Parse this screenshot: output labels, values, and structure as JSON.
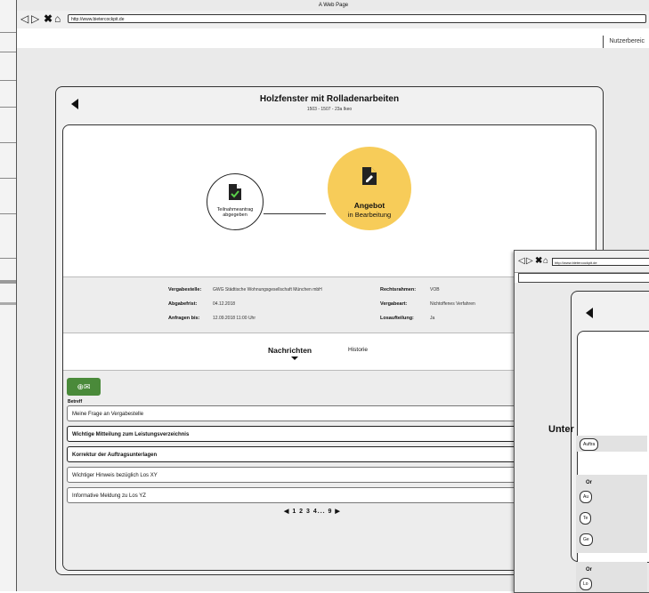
{
  "browser": {
    "window_title": "A Web Page",
    "url": "http://www.bietercockpit.de",
    "user_area": "Nutzerbereic"
  },
  "project": {
    "title": "Holzfenster mit Rolladenarbeiten",
    "subtitle": "1503 - 1507 - 23a Ikeo"
  },
  "status": {
    "step1_label": "Teilnahmeantrag abgegeben",
    "step2_title": "Angebot",
    "step2_sub": "in Bearbeitung",
    "accent_color": "#f7cc59"
  },
  "meta": {
    "vergabestelle_label": "Vergabestelle:",
    "vergabestelle_value": "GWG Städtische Wohnungsgesellschaft München mbH",
    "abgabefrist_label": "Abgabefrist:",
    "abgabefrist_value": "04.12.2018",
    "anfragen_label": "Anfragen bis:",
    "anfragen_value": "12.09.2018 11:00 Uhr",
    "rechtsrahmen_label": "Rechtsrahmen:",
    "rechtsrahmen_value": "VOB",
    "vergabeart_label": "Vergabeart:",
    "vergabeart_value": "Nichtoffenes Verfahren",
    "losaufteilung_label": "Losaufteilung:",
    "losaufteilung_value": "Ja"
  },
  "tabs": {
    "active": "Nachrichten",
    "other": "Historie"
  },
  "messages": {
    "new_button_color": "#4a8a3a",
    "column_header": "Betreff",
    "rows": [
      {
        "subject": "Meine Frage an Vergabestelle",
        "bold": false
      },
      {
        "subject": "Wichtige Mitteilung zum Leistungsverzeichnis",
        "bold": true
      },
      {
        "subject": "Korrektur der Auftragsunterlagen",
        "bold": true
      },
      {
        "subject": "Wichtiger Hinweis bezüglich Los XY",
        "bold": false
      },
      {
        "subject": "Informative Meldung zu Los YZ",
        "bold": false
      }
    ],
    "pagination": "1 2 3 4... 9"
  },
  "second_window": {
    "url": "http://www.bietercockpit.de",
    "heading": "Unter",
    "pill1": "Auftra",
    "section1": "Or",
    "pills_a": [
      "Au",
      "Te",
      "Ge"
    ],
    "section2": "Or",
    "pill_last": "Lo"
  }
}
